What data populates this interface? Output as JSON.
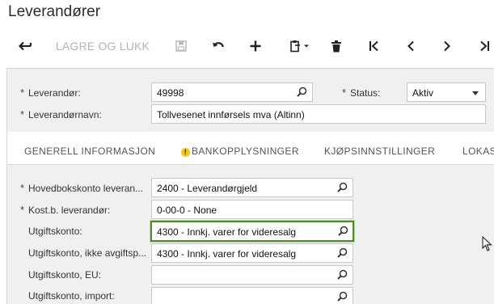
{
  "page": {
    "title": "Leverandører"
  },
  "toolbar": {
    "save_close_label": "LAGRE OG LUKK",
    "icons": [
      "back-arrow-icon",
      "save-icon",
      "undo-icon",
      "plus-icon",
      "clipboard-icon",
      "delete-icon",
      "first-record-icon",
      "previous-icon",
      "next-icon",
      "last-record-icon"
    ]
  },
  "header": {
    "vendor_label": "Leverandør:",
    "vendor_value": "49998",
    "status_label": "Status:",
    "status_value": "Aktiv",
    "vendor_name_label": "Leverandørnavn:",
    "vendor_name_value": "Tollvesenet innførsels mva (Altinn)",
    "required_mark": "*"
  },
  "tabs": {
    "general": "GENERELL INFORMASJON",
    "bank": "BANKOPPLYSNINGER",
    "bank_warning": "!",
    "purchase": "KJØPSINNSTILLINGER",
    "locations": "LOKAS"
  },
  "form": {
    "rows": [
      {
        "label": "Hovedbokskonto leveran...",
        "value": "2400 - Leverandørgjeld",
        "required": true
      },
      {
        "label": "Kost.b. leverandør:",
        "value": "0-00-0 - None",
        "required": true
      },
      {
        "label": "Utgiftskonto:",
        "value": "4300 - Innkj. varer for videresalg",
        "required": false
      },
      {
        "label": "Utgiftskonto, ikke avgiftsp...",
        "value": "4300 - Innkj. varer for videresalg",
        "required": false
      },
      {
        "label": "Utgiftskonto, EU:",
        "value": "",
        "required": false
      },
      {
        "label": "Utgiftskonto, import:",
        "value": "",
        "required": false
      }
    ]
  },
  "colors": {
    "highlight_border": "#4f8a2c",
    "panel_bg": "#f0f0f0",
    "warning": "#f5c518"
  }
}
